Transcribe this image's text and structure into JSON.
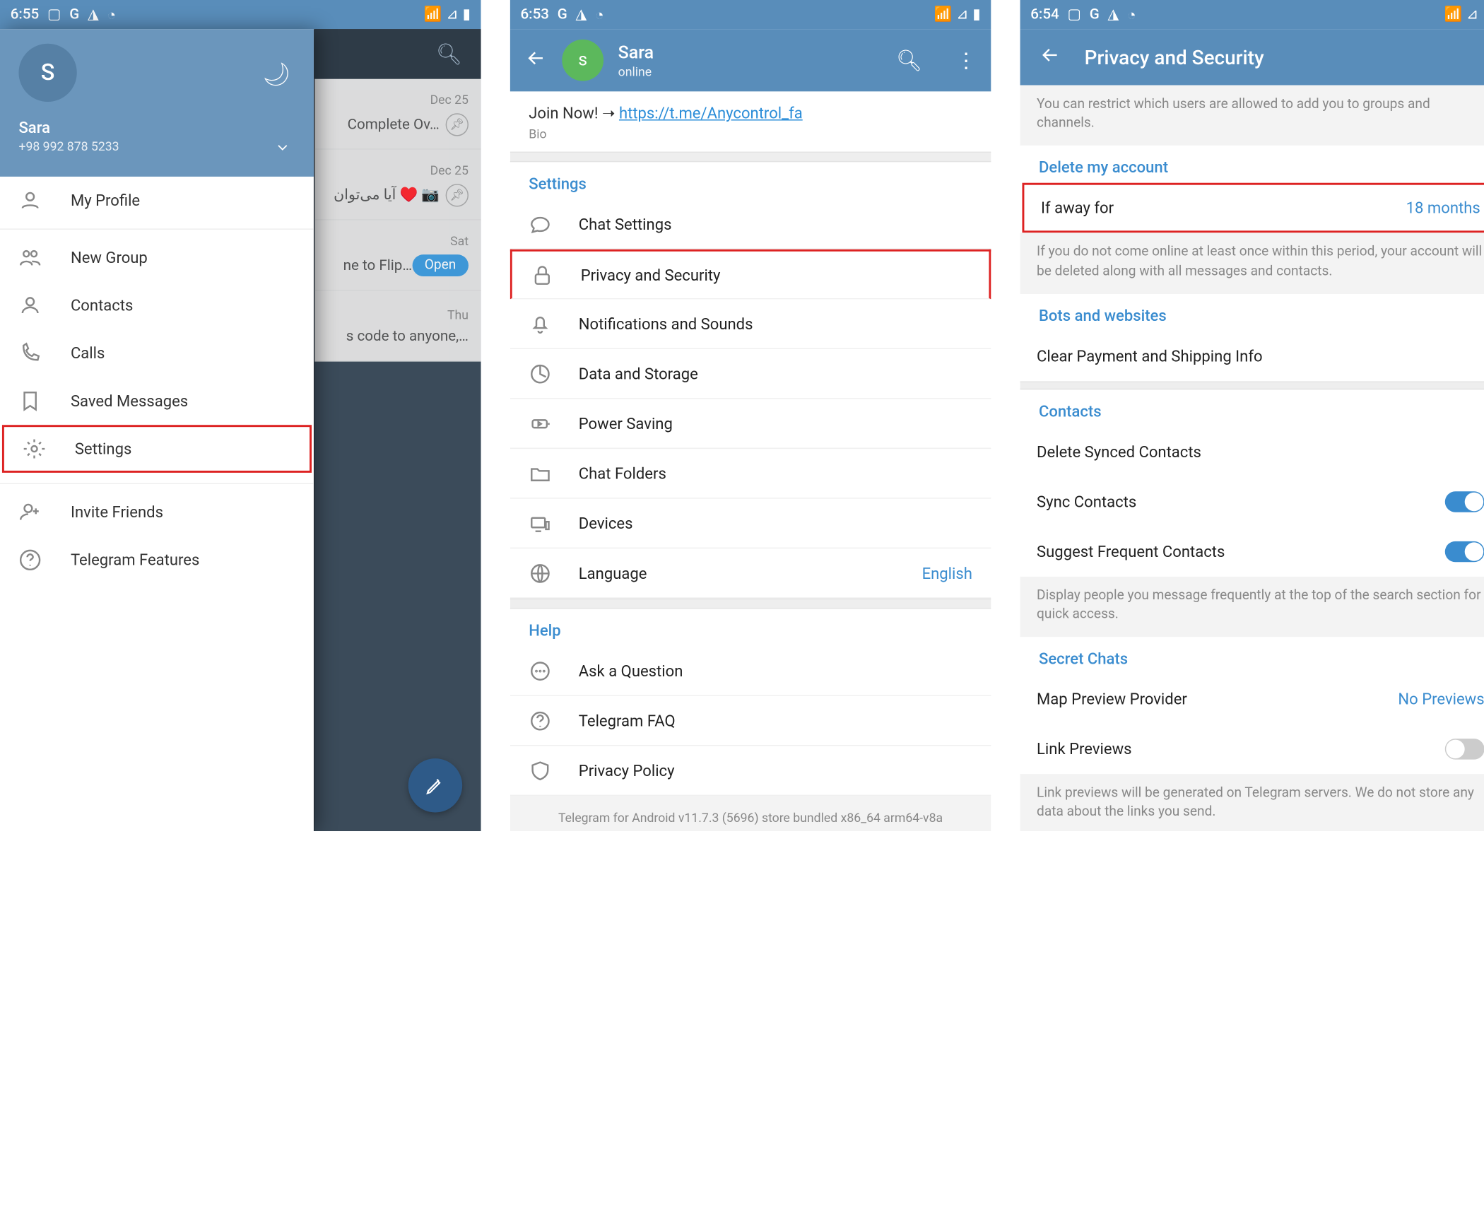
{
  "screen1": {
    "status": {
      "time": "6:55",
      "icons": [
        "image",
        "G",
        "A",
        "clock"
      ]
    },
    "drawer": {
      "avatar_initial": "S",
      "name": "Sara",
      "phone": "+98 992 878 5233",
      "items": [
        {
          "icon": "profile",
          "label": "My Profile"
        },
        {
          "icon": "group",
          "label": "New Group"
        },
        {
          "icon": "contacts",
          "label": "Contacts"
        },
        {
          "icon": "calls",
          "label": "Calls"
        },
        {
          "icon": "saved",
          "label": "Saved Messages"
        },
        {
          "icon": "settings",
          "label": "Settings",
          "highlight": true
        }
      ],
      "footer_items": [
        {
          "icon": "invite",
          "label": "Invite Friends"
        },
        {
          "icon": "help",
          "label": "Telegram Features"
        }
      ]
    },
    "behind": {
      "rows": [
        {
          "date": "Dec 25",
          "snippet": "Complete Ov…",
          "pinned": true
        },
        {
          "date": "Dec 25",
          "snippet": "آیا می‌توان ♥️ 📷",
          "pinned": true
        },
        {
          "date": "Sat",
          "snippet": "ne to Flip…",
          "open": true
        },
        {
          "date": "Thu",
          "snippet": "s code to anyone,…"
        }
      ]
    }
  },
  "screen2": {
    "status": {
      "time": "6:53"
    },
    "header": {
      "initial": "s",
      "name": "Sara",
      "sub": "online"
    },
    "bio": {
      "prefix": "Join Now!  ➝  ",
      "link_text": "https://t.me/Anycontrol_fa",
      "label": "Bio"
    },
    "settings_label": "Settings",
    "settings": [
      {
        "icon": "chat",
        "label": "Chat Settings"
      },
      {
        "icon": "lock",
        "label": "Privacy and Security",
        "highlight": true
      },
      {
        "icon": "bell",
        "label": "Notifications and Sounds"
      },
      {
        "icon": "data",
        "label": "Data and Storage"
      },
      {
        "icon": "power",
        "label": "Power Saving"
      },
      {
        "icon": "folder",
        "label": "Chat Folders"
      },
      {
        "icon": "devices",
        "label": "Devices"
      },
      {
        "icon": "globe",
        "label": "Language",
        "value": "English"
      }
    ],
    "help_label": "Help",
    "help": [
      {
        "icon": "ask",
        "label": "Ask a Question"
      },
      {
        "icon": "faq",
        "label": "Telegram FAQ"
      },
      {
        "icon": "shield",
        "label": "Privacy Policy"
      }
    ],
    "version": "Telegram for Android v11.7.3 (5696) store bundled x86_64 arm64-v8a"
  },
  "screen3": {
    "status": {
      "time": "6:54"
    },
    "title": "Privacy and Security",
    "groups_hint": "You can restrict which users are allowed to add you to groups and channels.",
    "sections": {
      "delete": {
        "label": "Delete my account",
        "row": {
          "label": "If away for",
          "value": "18 months",
          "highlight": true
        },
        "hint": "If you do not come online at least once within this period, your account will be deleted along with all messages and contacts."
      },
      "bots": {
        "label": "Bots and websites",
        "row": {
          "label": "Clear Payment and Shipping Info"
        }
      },
      "contacts": {
        "label": "Contacts",
        "rows": [
          {
            "label": "Delete Synced Contacts"
          },
          {
            "label": "Sync Contacts",
            "toggle": true,
            "on": true
          },
          {
            "label": "Suggest Frequent Contacts",
            "toggle": true,
            "on": true
          }
        ],
        "hint": "Display people you message frequently at the top of the search section for quick access."
      },
      "secret": {
        "label": "Secret Chats",
        "rows": [
          {
            "label": "Map Preview Provider",
            "value": "No Previews"
          },
          {
            "label": "Link Previews",
            "toggle": true,
            "on": false
          }
        ],
        "hint": "Link previews will be generated on Telegram servers. We do not store any data about the links you send."
      }
    }
  }
}
